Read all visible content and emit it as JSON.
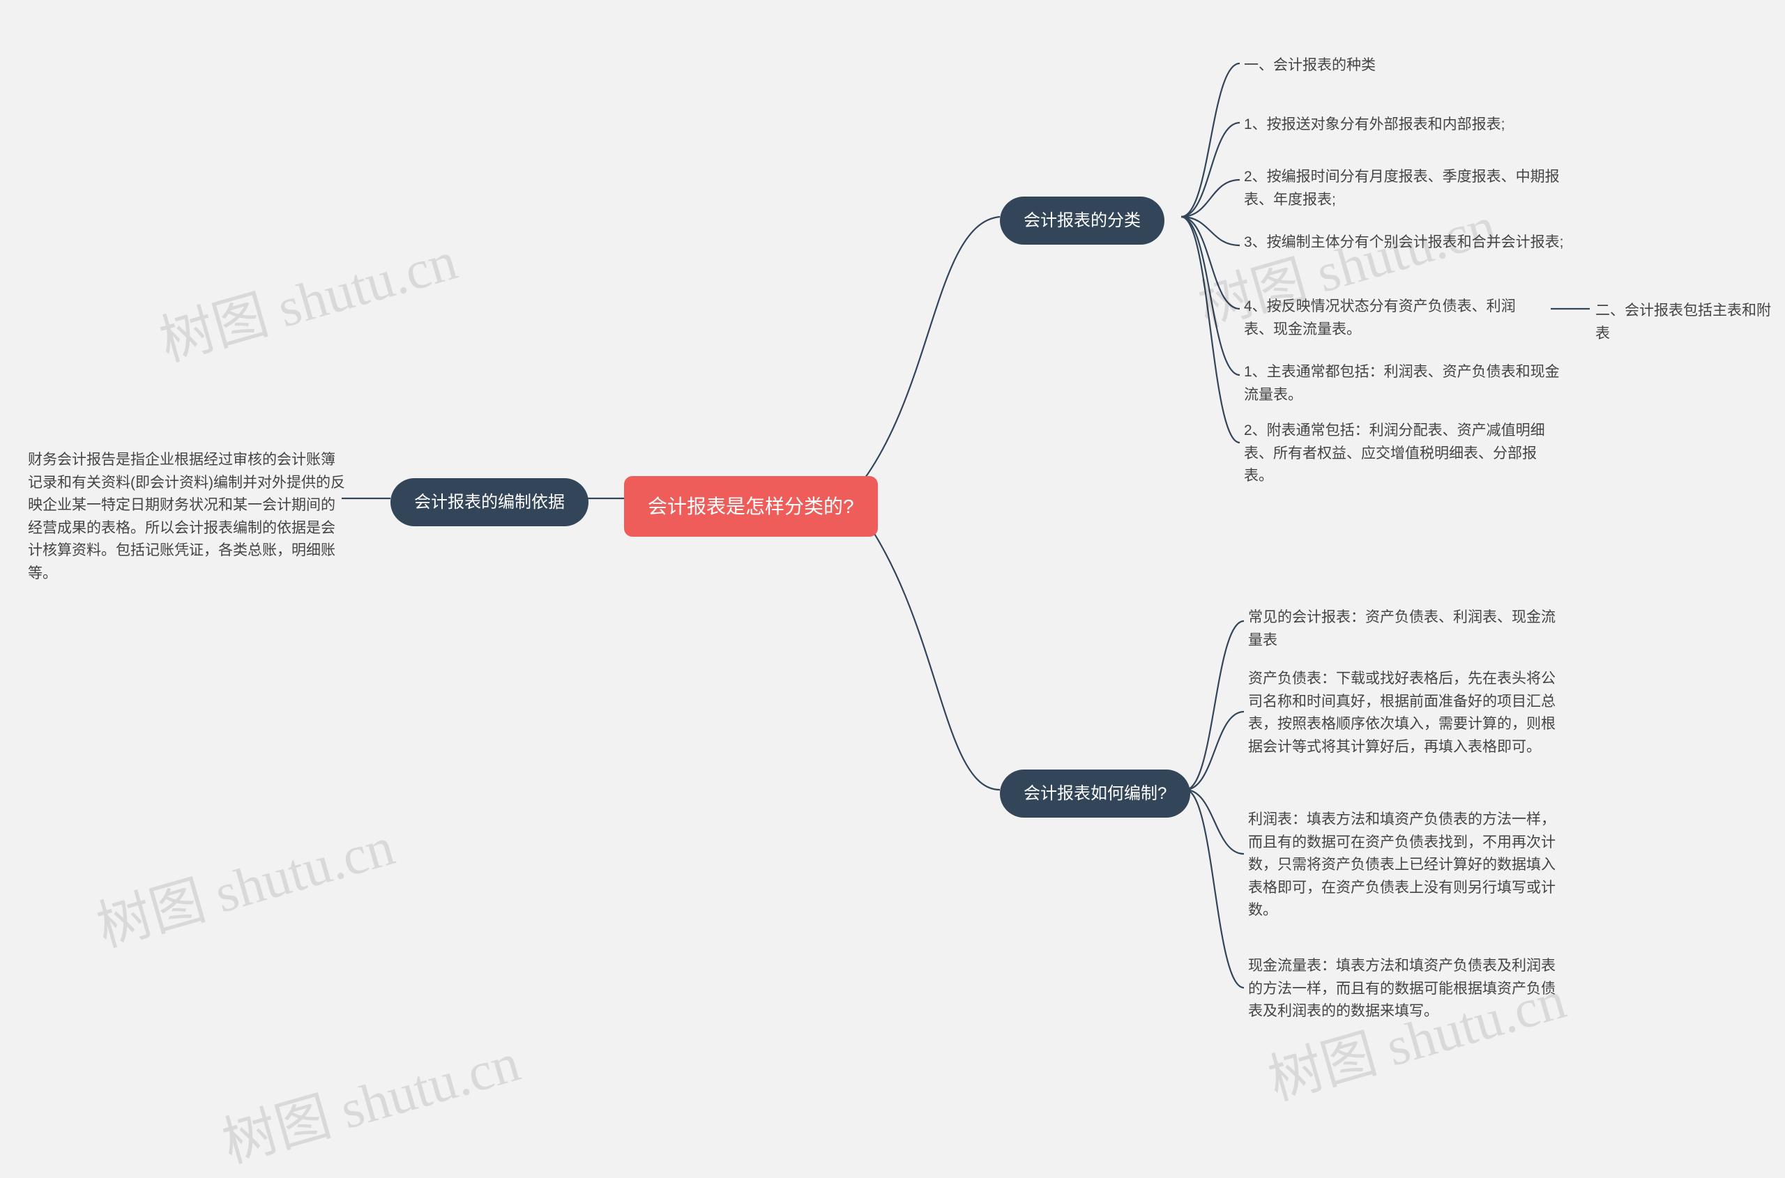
{
  "root": {
    "title": "会计报表是怎样分类的?"
  },
  "left": {
    "branch": {
      "label": "会计报表的编制依据"
    },
    "leaf": {
      "text": "财务会计报告是指企业根据经过审核的会计账簿记录和有关资料(即会计资料)编制并对外提供的反映企业某一特定日期财务状况和某一会计期间的经营成果的表格。所以会计报表编制的依据是会计核算资料。包括记账凭证，各类总账，明细账等。"
    }
  },
  "right_top": {
    "branch": {
      "label": "会计报表的分类"
    },
    "items": [
      {
        "text": "一、会计报表的种类"
      },
      {
        "text": "1、按报送对象分有外部报表和内部报表;"
      },
      {
        "text": "2、按编报时间分有月度报表、季度报表、中期报表、年度报表;"
      },
      {
        "text": "3、按编制主体分有个别会计报表和合并会计报表;"
      },
      {
        "text": "4、按反映情况状态分有资产负债表、利润表、现金流量表。"
      },
      {
        "text": "1、主表通常都包括：利润表、资产负债表和现金流量表。"
      },
      {
        "text": "2、附表通常包括：利润分配表、资产减值明细表、所有者权益、应交增值税明细表、分部报表。"
      }
    ],
    "side_leaf": {
      "text": "二、会计报表包括主表和附表"
    }
  },
  "right_bottom": {
    "branch": {
      "label": "会计报表如何编制?"
    },
    "items": [
      {
        "text": "常见的会计报表：资产负债表、利润表、现金流量表"
      },
      {
        "text": "资产负债表：下载或找好表格后，先在表头将公司名称和时间真好，根据前面准备好的项目汇总表，按照表格顺序依次填入，需要计算的，则根据会计等式将其计算好后，再填入表格即可。"
      },
      {
        "text": "利润表：填表方法和填资产负债表的方法一样，而且有的数据可在资产负债表找到，不用再次计数，只需将资产负债表上已经计算好的数据填入表格即可，在资产负债表上没有则另行填写或计数。"
      },
      {
        "text": "现金流量表：填表方法和填资产负债表及利润表的方法一样，而且有的数据可能根据填资产负债表及利润表的的数据来填写。"
      }
    ]
  },
  "watermark": {
    "text": "树图 shutu.cn"
  }
}
